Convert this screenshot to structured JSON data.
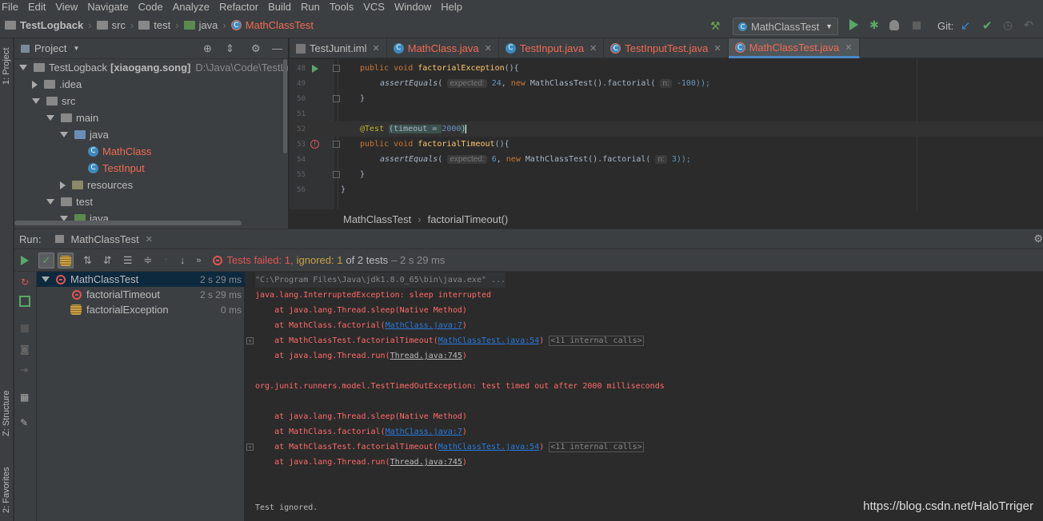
{
  "menu": [
    "File",
    "Edit",
    "View",
    "Navigate",
    "Code",
    "Analyze",
    "Refactor",
    "Build",
    "Run",
    "Tools",
    "VCS",
    "Window",
    "Help"
  ],
  "nav": {
    "project": "TestLogback",
    "crumbs": [
      "src",
      "test",
      "java"
    ],
    "file": "MathClassTest",
    "run_config": "MathClassTest",
    "git_label": "Git:"
  },
  "side": {
    "project_tab": "1: Project",
    "structure_tab": "Z: Structure",
    "favorites_tab": "2: Favorites"
  },
  "project_panel": {
    "title": "Project",
    "tree": [
      {
        "label": "TestLogback",
        "bold_suffix": "[xiaogang.song]",
        "path": "D:\\Java\\Code\\TestLo"
      },
      {
        "label": ".idea"
      },
      {
        "label": "src"
      },
      {
        "label": "main"
      },
      {
        "label": "java"
      },
      {
        "label": "MathClass"
      },
      {
        "label": "TestInput"
      },
      {
        "label": "resources"
      },
      {
        "label": "test"
      },
      {
        "label": "java"
      }
    ]
  },
  "tabs": [
    "TestJunit.iml",
    "MathClass.java",
    "TestInput.java",
    "TestInputTest.java",
    "MathClassTest.java"
  ],
  "editor": {
    "line_numbers": [
      "48",
      "49",
      "50",
      "51",
      "52",
      "53",
      "54",
      "55",
      "56"
    ],
    "l48_kw": "public void ",
    "l48_fn": "factorialException",
    "l48_rest": "(){",
    "l49_call": "assertEquals",
    "l49_hint": "expected:",
    "l49_num": "24",
    "l49_new": "new ",
    "l49_mid": "MathClassTest().factorial(",
    "l49_hint2": "n:",
    "l49_end": "-100));",
    "l50": "}",
    "l52_ann": "@Test ",
    "l52_mid": "(timeout = ",
    "l52_num": "2000",
    "l52_end": ")",
    "l53_kw": "public void ",
    "l53_fn": "factorialTimeout",
    "l53_rest": "(){",
    "l54_call": "assertEquals",
    "l54_hint": "expected:",
    "l54_num": "6",
    "l54_new": "new ",
    "l54_mid": "MathClassTest().factorial(",
    "l54_hint2": "n:",
    "l54_end": "3));",
    "l55": "}",
    "l56": "}"
  },
  "editor_breadcrumb": {
    "cls": "MathClassTest",
    "method": "factorialTimeout()"
  },
  "run": {
    "label": "Run:",
    "tab": "MathClassTest",
    "status_failed": "Tests failed: 1,",
    "status_ignored": "ignored: 1",
    "status_rest": "of 2 tests",
    "status_time": "– 2 s 29 ms"
  },
  "test_tree": [
    {
      "name": "MathClassTest",
      "time": "2 s 29 ms"
    },
    {
      "name": "factorialTimeout",
      "time": "2 s 29 ms"
    },
    {
      "name": "factorialException",
      "time": "0 ms"
    }
  ],
  "console": {
    "cmd": "\"C:\\Program Files\\Java\\jdk1.8.0_65\\bin\\java.exe\" ...",
    "e1": "java.lang.InterruptedException: sleep interrupted",
    "e1_at1": "    at java.lang.Thread.sleep(Native Method)",
    "e1_at2_pre": "    at MathClass.factorial(",
    "e1_at2_link": "MathClass.java:7",
    "e1_at2_post": ")",
    "e1_at3_pre": "    at MathClassTest.factorialTimeout(",
    "e1_at3_link": "MathClassTest.java:54",
    "e1_at3_post": ")",
    "e1_at3_internal": "<11 internal calls>",
    "e1_at4_pre": "    at java.lang.Thread.run(",
    "e1_at4_link": "Thread.java:745",
    "e1_at4_post": ")",
    "e2": "org.junit.runners.model.TestTimedOutException: test timed out after 2000 milliseconds",
    "e2_at1": "    at java.lang.Thread.sleep(Native Method)",
    "e2_at2_pre": "    at MathClass.factorial(",
    "e2_at2_link": "MathClass.java:7",
    "e2_at2_post": ")",
    "e2_at3_pre": "    at MathClassTest.factorialTimeout(",
    "e2_at3_link": "MathClassTest.java:54",
    "e2_at3_post": ")",
    "e2_at3_internal": "<11 internal calls>",
    "e2_at4_pre": "    at java.lang.Thread.run(",
    "e2_at4_link": "Thread.java:745",
    "e2_at4_post": ")",
    "ignored": "Test ignored."
  },
  "watermark": "https://blog.csdn.net/HaloTrriger"
}
